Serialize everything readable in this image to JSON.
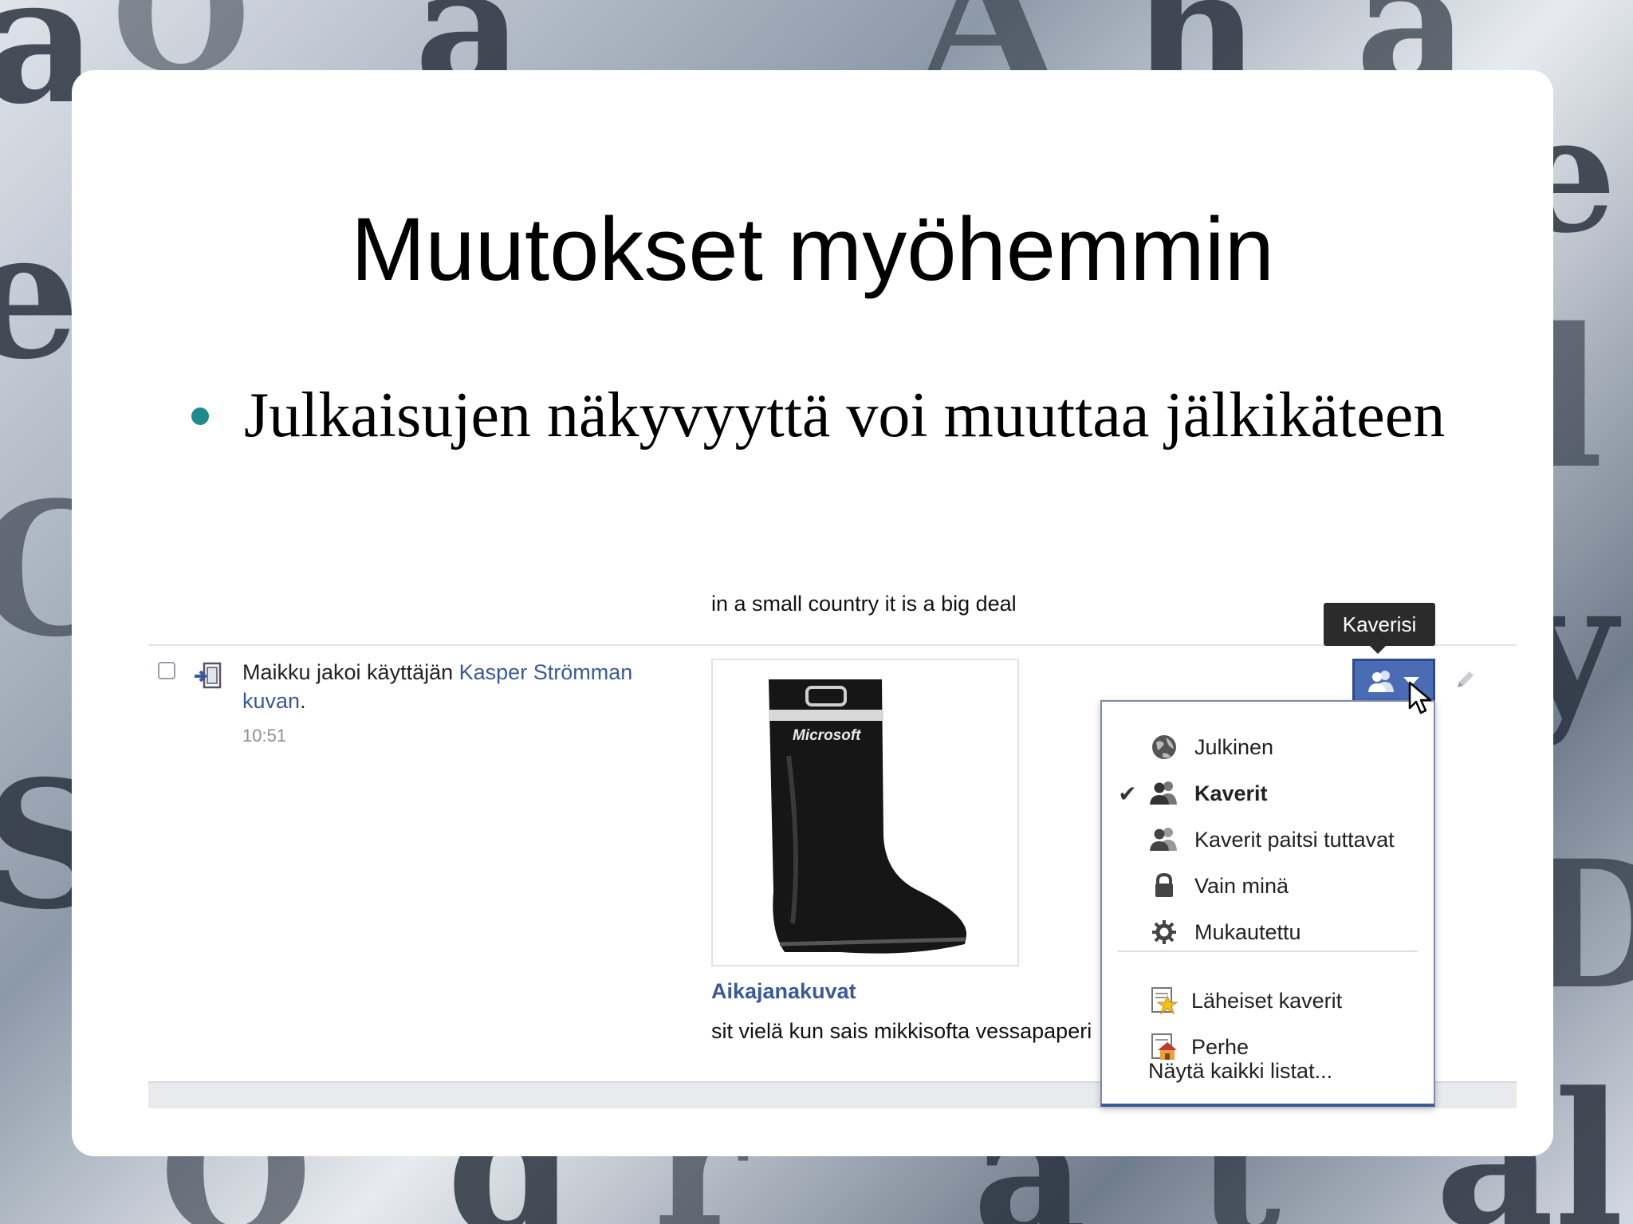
{
  "slide": {
    "title": "Muutokset myöhemmin",
    "bullet": "Julkaisujen näkyvyyttä voi muuttaa jälkikäteen",
    "bullet_color": "#1f8a8a"
  },
  "facebook": {
    "previous_text": "in a small country it is a big deal",
    "story": {
      "prefix": "Maikku jakoi käyttäjän",
      "author_link": "Kasper Strömman",
      "photo_link": "kuvan",
      "suffix": ".",
      "time": "10:51",
      "icon": "share-icon"
    },
    "photo_brand": "Microsoft",
    "album_link": "Aikajanakuvat",
    "caption": "sit vielä kun sais mikkisofta vessapaperi",
    "tooltip": "Kaverisi",
    "audience_button_icon": "friends-icon",
    "menu": {
      "items": [
        {
          "label": "Julkinen",
          "icon": "globe-icon",
          "selected": false
        },
        {
          "label": "Kaverit",
          "icon": "friends-icon",
          "selected": true
        },
        {
          "label": "Kaverit paitsi tuttavat",
          "icon": "friends-except-icon",
          "selected": false
        },
        {
          "label": "Vain minä",
          "icon": "lock-icon",
          "selected": false
        },
        {
          "label": "Mukautettu",
          "icon": "gear-icon",
          "selected": false
        }
      ],
      "lists": [
        {
          "label": "Läheiset kaverit",
          "icon": "star-list-icon"
        },
        {
          "label": "Perhe",
          "icon": "house-list-icon"
        }
      ],
      "show_all": "Näytä kaikki listat...",
      "check_mark": "✔"
    },
    "colors": {
      "link": "#3b5998",
      "button": "#4a6cb5"
    }
  }
}
